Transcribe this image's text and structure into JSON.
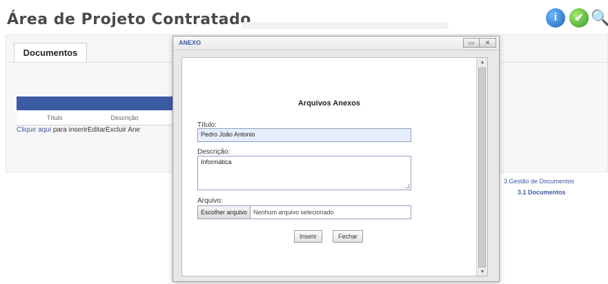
{
  "page": {
    "title": "Área de Projeto Contratado"
  },
  "toolbar": {
    "help_icon": "info-circle",
    "help_glyph": "i",
    "confirm_icon": "checkmark",
    "confirm_glyph": "✔",
    "search_icon": "magnifier",
    "search_glyph": "🔍"
  },
  "tabs": {
    "documents": "Documentos"
  },
  "table": {
    "columns": [
      "Título",
      "Descrição"
    ],
    "row_link": "Clique aqui",
    "row_text": " para inserirEditarExcluir Ane"
  },
  "nav": {
    "section": "3.Gestão de Documentos",
    "item": "3.1 Documentos"
  },
  "dialog": {
    "title": "ANEXO",
    "win_buttons": [
      "Restaurar",
      "Fechar"
    ],
    "form_title": "Arquivos Anexos",
    "titulo_label": "Título:",
    "titulo_value": "Pedro João Antonio",
    "descricao_label": "Descrição:",
    "descricao_value": "Informática",
    "arquivo_label": "Arquivo:",
    "file_button": "Escolher arquivo",
    "file_status": "Nenhum arquivo selecionado",
    "insert_button": "Inserir",
    "close_button": "Fechar"
  },
  "colors": {
    "accent": "#3b5ba3",
    "input_fill": "#e6eefb",
    "help_blue": "#1d63b8",
    "ok_green": "#2f9a2a"
  }
}
